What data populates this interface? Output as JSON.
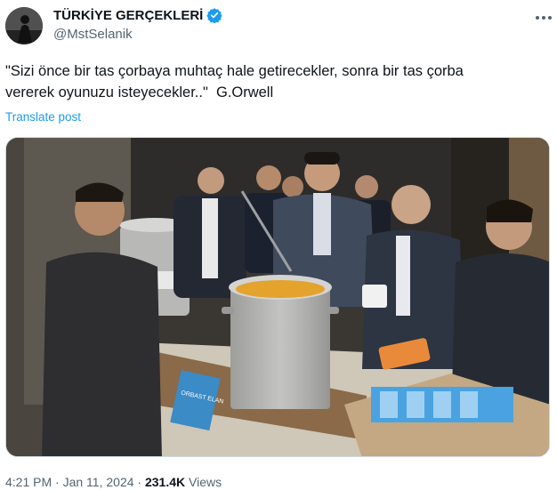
{
  "author": {
    "name": "TÜRKİYE GERÇEKLERİ",
    "handle": "@MstSelanik",
    "verified": true,
    "avatar_icon": "avatar-silhouette-icon"
  },
  "tweet": {
    "text_line1": "\"Sizi önce bir tas çorbaya muhtaç hale getirecekler, sonra bir tas çorba",
    "text_line2": "vererek oyunuzu isteyecekler..\"  G.Orwell",
    "translate_label": "Translate post",
    "media_icon": "video-thumbnail",
    "stall_sign_text": "ORBAST ELAN"
  },
  "meta": {
    "time": "4:21 PM",
    "separator": "·",
    "date": "Jan 11, 2024",
    "views_count": "231.4K",
    "views_label": "Views"
  },
  "colors": {
    "accent": "#1d9bf0",
    "text_primary": "#0f1419",
    "text_secondary": "#536471"
  }
}
